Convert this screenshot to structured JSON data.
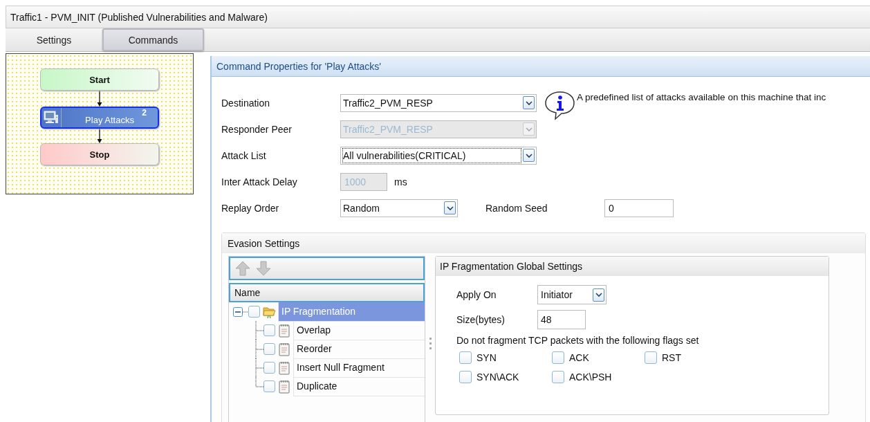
{
  "window": {
    "title": "Traffic1 - PVM_INIT (Published Vulnerabilities and Malware)"
  },
  "tabs": [
    {
      "label": "Settings",
      "selected": false
    },
    {
      "label": "Commands",
      "selected": true
    }
  ],
  "flow": {
    "nodes": [
      {
        "label": "Start",
        "kind": "start",
        "selected": false
      },
      {
        "label": "Play Attacks",
        "kind": "command",
        "selected": true,
        "badge": "2"
      },
      {
        "label": "Stop",
        "kind": "stop",
        "selected": false
      }
    ]
  },
  "properties": {
    "title": "Command Properties for 'Play Attacks'",
    "fields": [
      {
        "label": "Destination",
        "kind": "dropdown",
        "value": "Traffic2_PVM_RESP",
        "disabled": false,
        "focused": false,
        "info": "A predefined list of attacks available on this machine that inc"
      },
      {
        "label": "Responder Peer",
        "kind": "dropdown",
        "value": "Traffic2_PVM_RESP",
        "disabled": true,
        "focused": false
      },
      {
        "label": "Attack List",
        "kind": "dropdown",
        "value": "All vulnerabilities(CRITICAL)",
        "disabled": false,
        "focused": true
      },
      {
        "label": "Inter Attack Delay",
        "kind": "number",
        "value": "1000",
        "unit": "ms",
        "disabled": true
      },
      {
        "label": "Replay Order",
        "kind": "dropdown",
        "value": "Random",
        "disabled": false,
        "focused": false,
        "side": {
          "label": "Random Seed",
          "value": "0"
        }
      }
    ]
  },
  "evasion": {
    "title": "Evasion Settings",
    "tree": {
      "column": "Name",
      "items": [
        {
          "label": "IP Fragmentation",
          "checked": false,
          "selected": true,
          "expanded": true,
          "children": [
            {
              "label": "Overlap",
              "checked": false,
              "selected": false
            },
            {
              "label": "Reorder",
              "checked": false,
              "selected": false
            },
            {
              "label": "Insert Null Fragment",
              "checked": false,
              "selected": false
            },
            {
              "label": "Duplicate",
              "checked": false,
              "selected": false
            }
          ]
        }
      ]
    },
    "global_settings": {
      "title": "IP Fragmentation Global Settings",
      "apply_on": {
        "label": "Apply On",
        "value": "Initiator"
      },
      "size": {
        "label": "Size(bytes)",
        "value": "48"
      },
      "flags_label": "Do not fragment TCP packets with the following flags set",
      "flags": [
        {
          "label": "SYN",
          "checked": false
        },
        {
          "label": "ACK",
          "checked": false
        },
        {
          "label": "RST",
          "checked": false
        },
        {
          "label": "SYN\\ACK",
          "checked": false
        },
        {
          "label": "ACK\\PSH",
          "checked": false
        }
      ]
    }
  }
}
